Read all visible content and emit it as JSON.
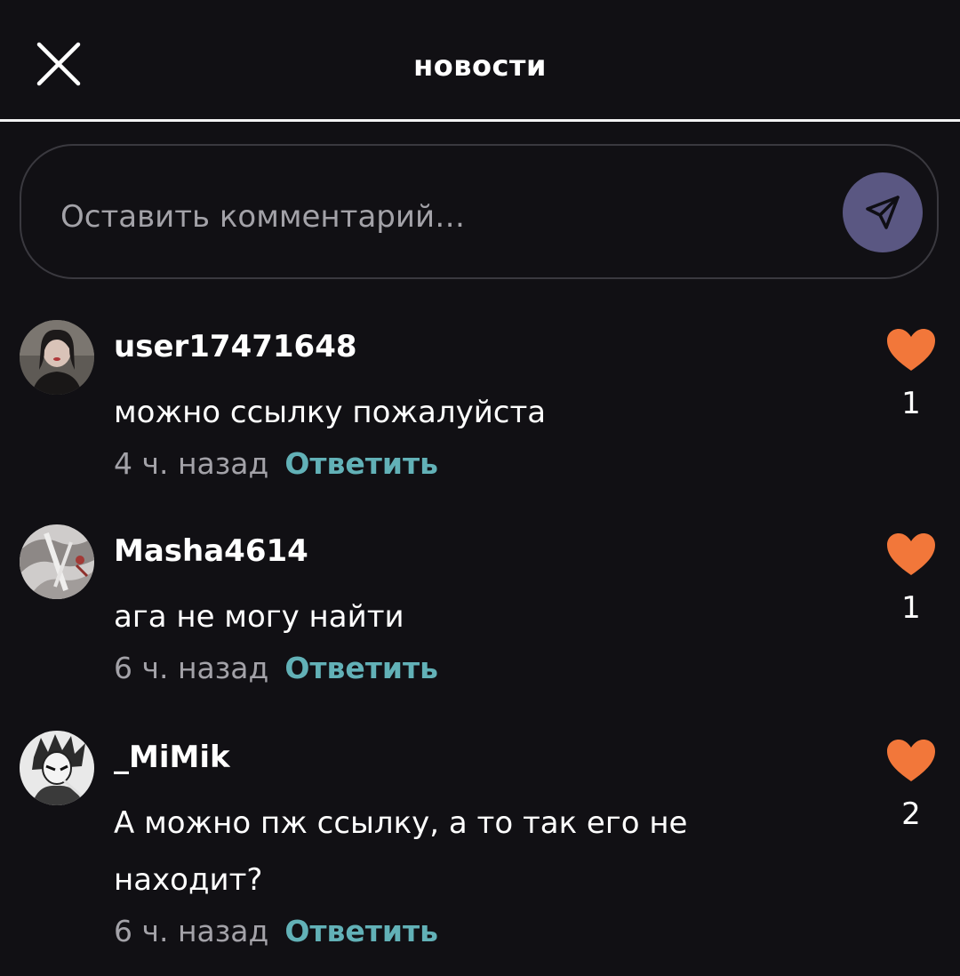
{
  "header": {
    "title": "новости",
    "close_icon": "close-icon"
  },
  "comment_input": {
    "placeholder": "Оставить комментарий…",
    "send_icon": "send-icon",
    "send_color": "#5a5782"
  },
  "comments": [
    {
      "username": "user17471648",
      "text": "можно ссылку пожалуйста",
      "time": "4 ч. назад",
      "reply_label": "Ответить",
      "likes": "1"
    },
    {
      "username": "Masha4614",
      "text": "ага не могу найти",
      "time": "6 ч. назад",
      "reply_label": "Ответить",
      "likes": "1"
    },
    {
      "username": "_MiMik",
      "text": "А можно пж ссылку, а то так его не находит?",
      "time": "6 ч. назад",
      "reply_label": "Ответить",
      "likes": "2"
    }
  ],
  "colors": {
    "background": "#111014",
    "heart": "#f2773a",
    "reply": "#62b1b7",
    "muted_text": "#a3a2a8"
  }
}
